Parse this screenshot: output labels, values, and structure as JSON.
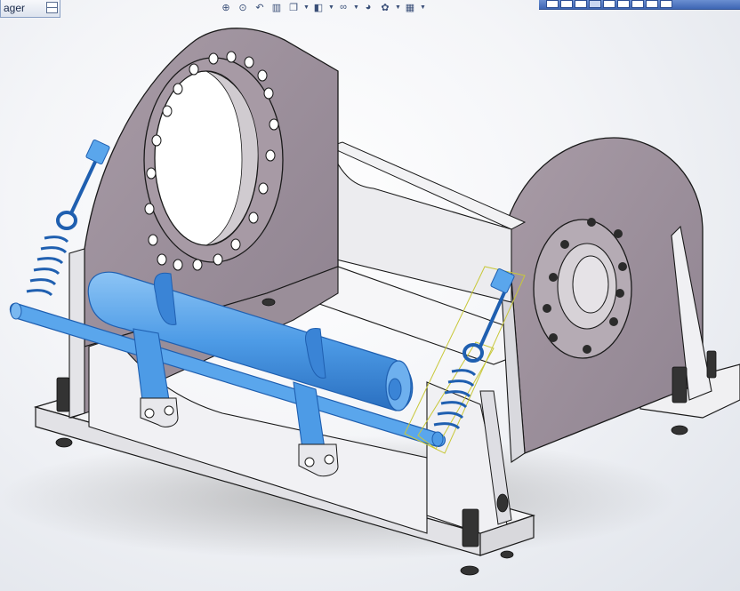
{
  "manager_tab": {
    "label": "ager"
  },
  "heads_up_toolbar": [
    {
      "icon": "zoom-to-fit-icon",
      "glyph": "⊕"
    },
    {
      "icon": "zoom-area-icon",
      "glyph": "⊙"
    },
    {
      "icon": "previous-view-icon",
      "glyph": "↶"
    },
    {
      "icon": "section-view-icon",
      "glyph": "▥"
    },
    {
      "icon": "view-orientation-icon",
      "glyph": "❐",
      "dropdown": true
    },
    {
      "icon": "display-style-icon",
      "glyph": "◧",
      "dropdown": true
    },
    {
      "icon": "hide-show-items-icon",
      "glyph": "∞",
      "dropdown": true
    },
    {
      "icon": "edit-appearance-icon",
      "glyph": "◕"
    },
    {
      "icon": "apply-scene-icon",
      "glyph": "✿",
      "dropdown": true
    },
    {
      "icon": "view-settings-icon",
      "glyph": "▦",
      "dropdown": true
    }
  ],
  "view_toolbar": {
    "button_count": 9,
    "active_index": 3
  },
  "colors": {
    "plate": "#9c8f9a",
    "plate_light": "#eeeff2",
    "edge": "#1a1a1a",
    "blue_part": "#4d9be6",
    "blue_dark": "#1f5fb0",
    "selection": "#c8c83a"
  }
}
